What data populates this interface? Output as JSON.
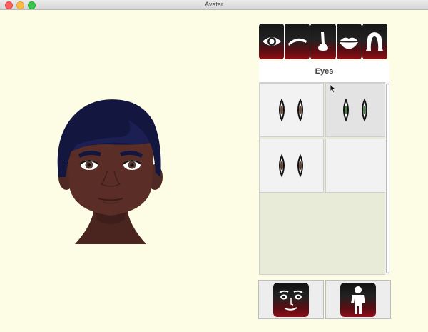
{
  "window": {
    "title": "Avatar"
  },
  "feature_tabs": [
    {
      "name": "eyes",
      "icon": "eye-icon"
    },
    {
      "name": "eyebrows",
      "icon": "eyebrow-icon"
    },
    {
      "name": "nose",
      "icon": "nose-icon"
    },
    {
      "name": "mouth",
      "icon": "lips-icon"
    },
    {
      "name": "hair",
      "icon": "hair-icon"
    }
  ],
  "section": {
    "label": "Eyes"
  },
  "eye_options": [
    {
      "id": "eyes-option-1",
      "iris_color": "#6b4a3a",
      "selected": false
    },
    {
      "id": "eyes-option-2",
      "iris_color": "#4f7a4f",
      "selected": true
    },
    {
      "id": "eyes-option-3",
      "iris_color": "#5a3b31",
      "selected": false
    },
    {
      "id": "eyes-option-4",
      "iris_color": "",
      "selected": false
    }
  ],
  "bottom_buttons": [
    {
      "name": "face-button",
      "icon": "face-icon"
    },
    {
      "name": "body-button",
      "icon": "person-icon"
    }
  ],
  "colors": {
    "background": "#fdfde6",
    "skin": "#5a2e26",
    "hair": "#13163e",
    "accent_dark": "#111111",
    "accent_red": "#8e0f18"
  }
}
